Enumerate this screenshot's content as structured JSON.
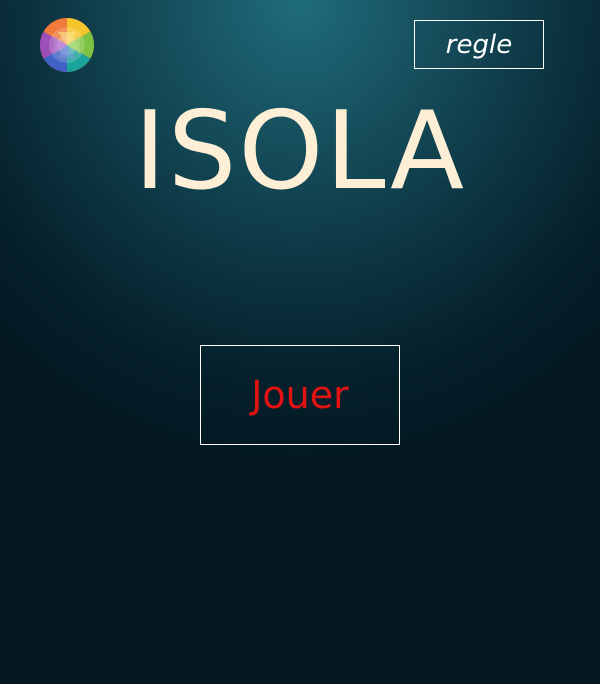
{
  "header": {
    "theme_icon": "color-wheel-icon",
    "rules_label": "regle"
  },
  "main": {
    "title": "ISOLA",
    "play_label": "Jouer"
  },
  "colors": {
    "background_top": "#1f6c7c",
    "background_bottom": "#031720",
    "title": "#fdefd6",
    "play_text": "#e11212",
    "button_border": "#ffffff"
  }
}
